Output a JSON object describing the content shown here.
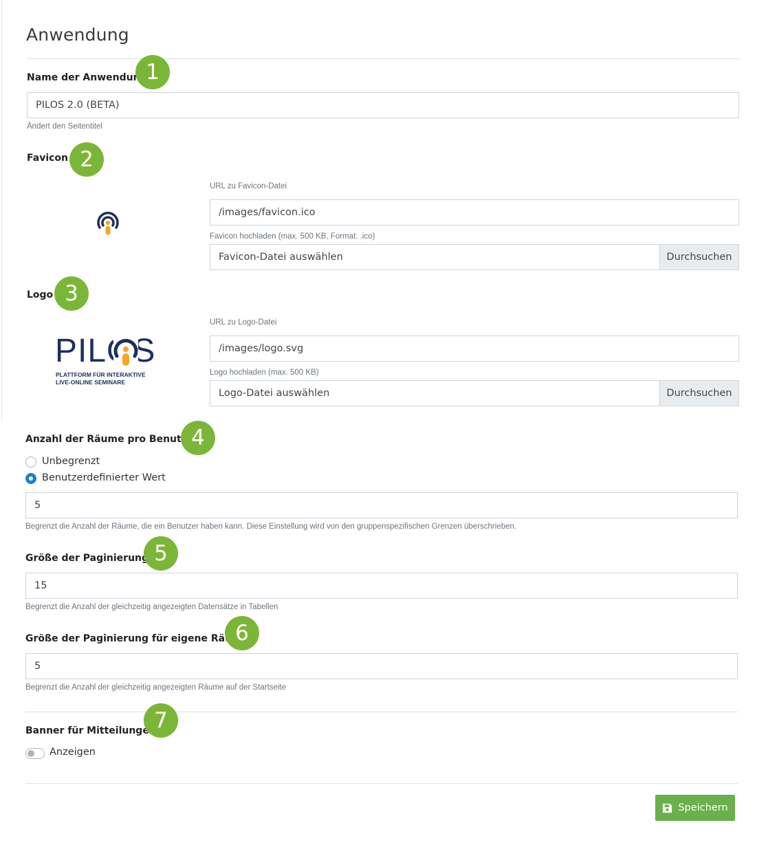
{
  "page": {
    "title": "Anwendung"
  },
  "name": {
    "label": "Name der Anwendung",
    "value": "PILOS 2.0 (BETA)",
    "help": "Ändert den Seitentitel",
    "badge": "1"
  },
  "favicon": {
    "label": "Favicon",
    "badge": "2",
    "url_label": "URL zu Favicon-Datei",
    "url_value": "/images/favicon.ico",
    "upload_label": "Favicon hochladen (max. 500 KB, Format: .ico)",
    "upload_placeholder": "Favicon-Datei auswählen",
    "browse": "Durchsuchen"
  },
  "logo": {
    "label": "Logo",
    "badge": "3",
    "url_label": "URL zu Logo-Datei",
    "url_value": "/images/logo.svg",
    "upload_label": "Logo hochladen (max. 500 KB)",
    "upload_placeholder": "Logo-Datei auswählen",
    "browse": "Durchsuchen",
    "brand_word": "PILOS",
    "brand_line1": "PLATTFORM FÜR INTERAKTIVE",
    "brand_line2": "LIVE-ONLINE SEMINARE"
  },
  "rooms": {
    "label": "Anzahl der Räume pro Benutzer",
    "badge": "4",
    "option_unlimited": "Unbegrenzt",
    "option_custom": "Benutzerdefinierter Wert",
    "selected": "custom",
    "value": "5",
    "help": "Begrenzt die Anzahl der Räume, die ein Benutzer haben kann. Diese Einstellung wird von den gruppenspezifischen Grenzen überschrieben."
  },
  "pagination": {
    "label": "Größe der Paginierung",
    "badge": "5",
    "value": "15",
    "help": "Begrenzt die Anzahl der gleichzeitig angezeigten Datensätze in Tabellen"
  },
  "own_rooms": {
    "label": "Größe der Paginierung für eigene Räume",
    "badge": "6",
    "value": "5",
    "help": "Begrenzt die Anzahl der gleichzeitig angezeigten Räume auf der Startseite"
  },
  "banner": {
    "label": "Banner für Mitteilungen",
    "badge": "7",
    "toggle_label": "Anzeigen",
    "enabled": false
  },
  "actions": {
    "save": "Speichern"
  },
  "colors": {
    "accent_green": "#7cb638",
    "save_green": "#6ab04c",
    "radio_blue": "#1a80d6",
    "logo_navy": "#1d2f5f",
    "logo_orange": "#f5a623"
  },
  "icons": {
    "favicon": "pilos-favicon-icon",
    "logo": "pilos-logo",
    "save": "floppy-disk-icon"
  }
}
